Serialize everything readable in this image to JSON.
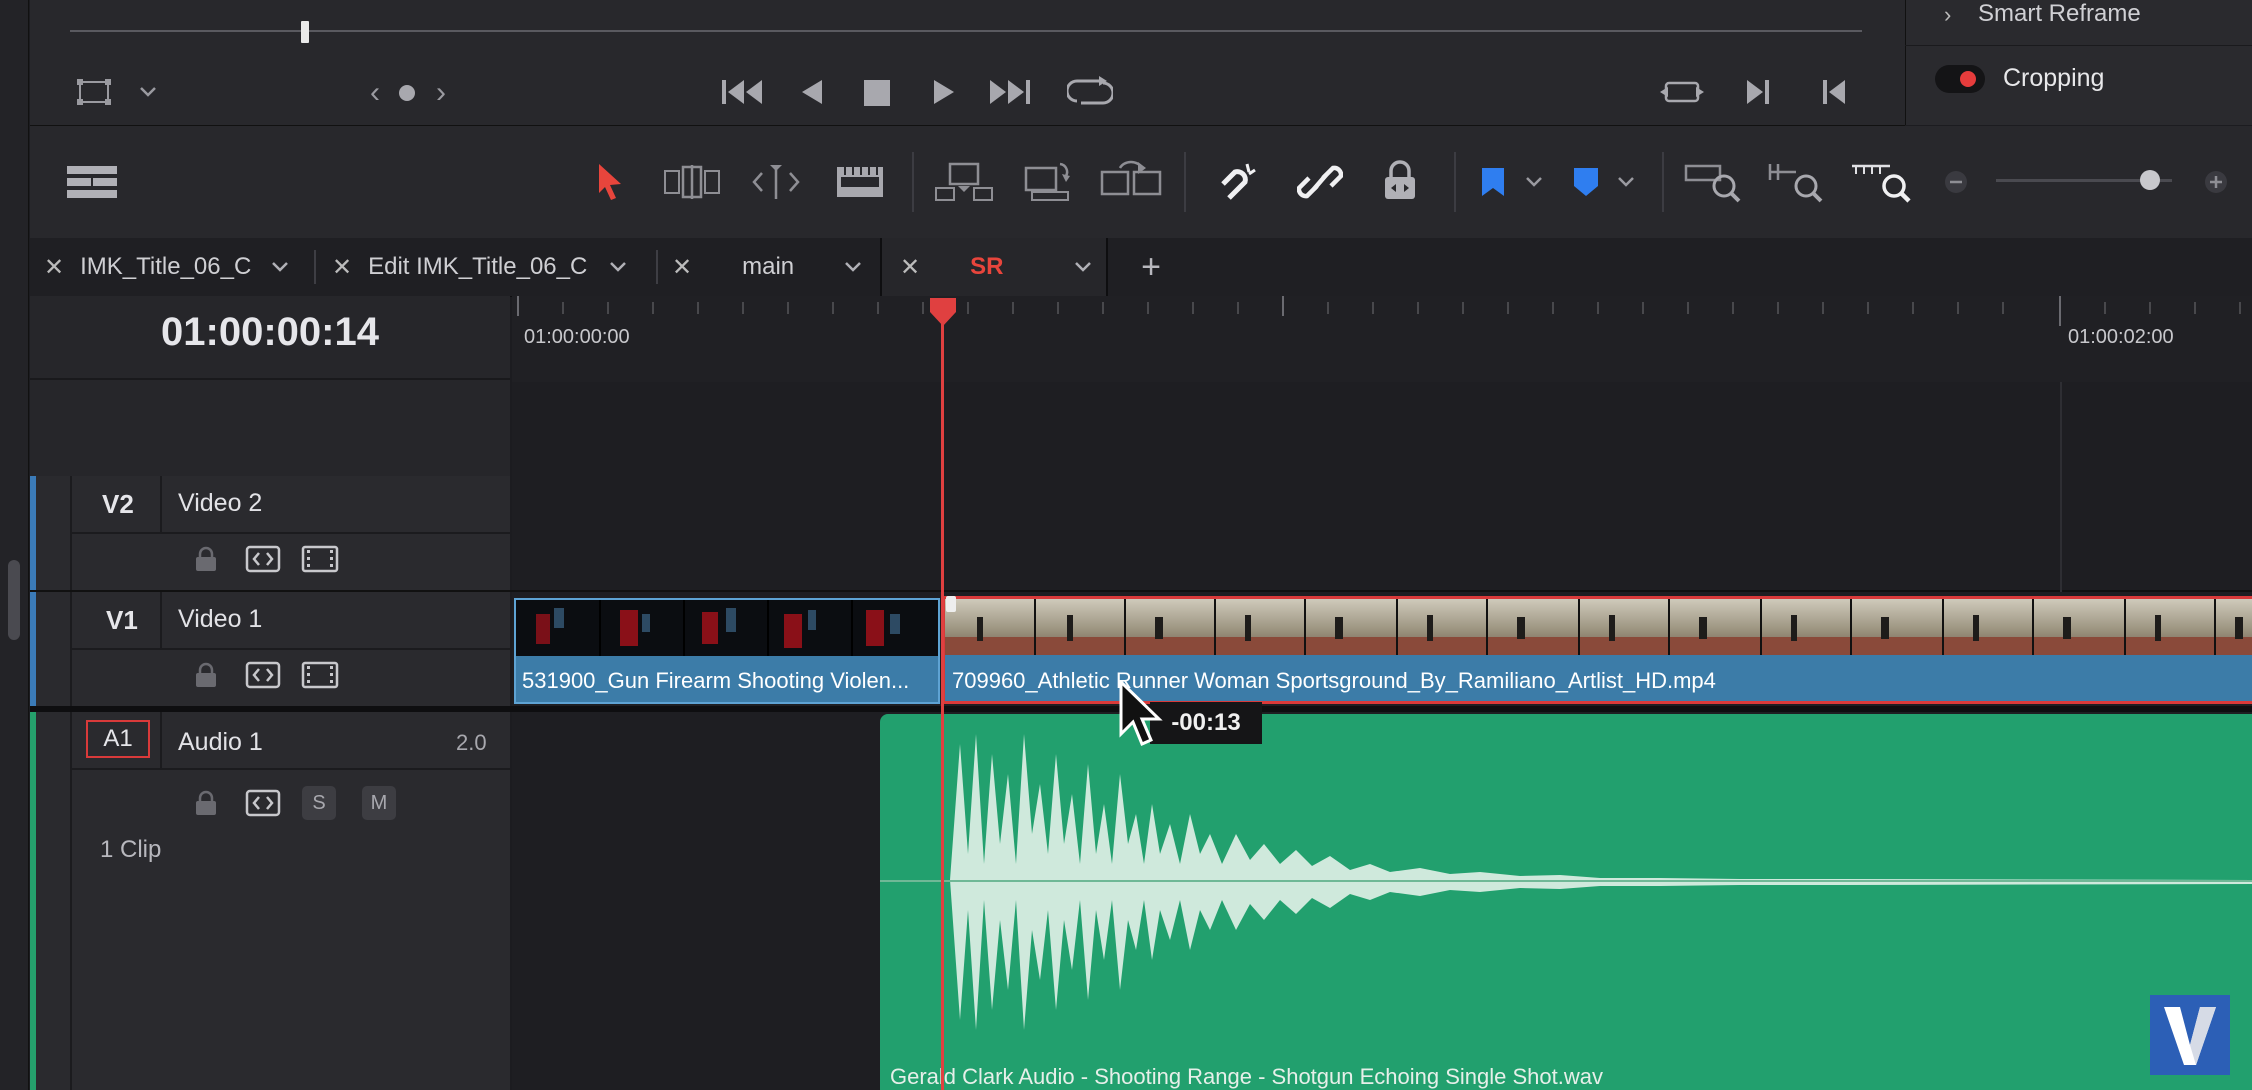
{
  "viewer": {
    "prev_marker": "‹",
    "next_marker": "›"
  },
  "inspector": {
    "smart_reframe_label": "Smart Reframe",
    "cropping_label": "Cropping",
    "cropping_enabled": true
  },
  "tabs": [
    {
      "label": "IMK_Title_06_C",
      "active": false
    },
    {
      "label": "Edit IMK_Title_06_C",
      "active": false
    },
    {
      "label": "main",
      "active": false
    },
    {
      "label": "SR",
      "active": true
    }
  ],
  "add_tab_label": "+",
  "timeline": {
    "timecode": "01:00:00:14",
    "ruler_labels": [
      "01:00:00:00",
      "01:00:02:00"
    ]
  },
  "tracks": {
    "v2": {
      "id": "V2",
      "name": "Video 2"
    },
    "v1": {
      "id": "V1",
      "name": "Video 1"
    },
    "a1": {
      "id": "A1",
      "name": "Audio 1",
      "channels": "2.0",
      "solo": "S",
      "mute": "M",
      "clip_count": "1 Clip"
    }
  },
  "clips": {
    "video1_clip1": "531900_Gun Firearm Shooting Violen...",
    "video1_clip2": "709960_Athletic Runner Woman Sportsground_By_Ramiliano_Artlist_HD.mp4",
    "audio1_clip1": "Gerald Clark Audio - Shooting Range - Shotgun Echoing Single Shot.wav"
  },
  "drag_tooltip": "-00:13",
  "colors": {
    "playhead": "#e04040",
    "video_clip": "#3c7ca8",
    "audio_clip": "#22a06e",
    "active_tab_text": "#e8453c",
    "video_track_bar": "#3b7bb8",
    "audio_track_bar": "#25a06c"
  },
  "logo_letter": "V"
}
